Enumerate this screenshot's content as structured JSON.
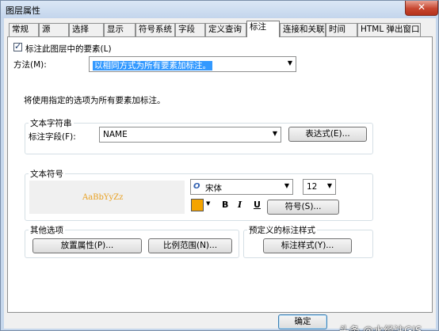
{
  "window": {
    "title": "图层属性",
    "close_glyph": "✕"
  },
  "tabs": [
    {
      "label": "常规"
    },
    {
      "label": "源"
    },
    {
      "label": "选择"
    },
    {
      "label": "显示"
    },
    {
      "label": "符号系统"
    },
    {
      "label": "字段"
    },
    {
      "label": "定义查询"
    },
    {
      "label": "标注"
    },
    {
      "label": "连接和关联"
    },
    {
      "label": "时间"
    },
    {
      "label": "HTML 弹出窗口"
    }
  ],
  "active_tab": "标注",
  "label_features": {
    "checked": true,
    "label": "标注此图层中的要素(L)"
  },
  "method": {
    "label": "方法(M):",
    "value": "以相同方式为所有要素加标注。"
  },
  "info_text": "将使用指定的选项为所有要素加标注。",
  "text_string": {
    "title": "文本字符串",
    "field_label": "标注字段(F):",
    "field_value": "NAME",
    "expression_button": "表达式(E)..."
  },
  "text_symbol": {
    "title": "文本符号",
    "preview": "AaBbYyZz",
    "font_value": "宋体",
    "size_value": "12",
    "color": "#f5a400",
    "bold": "B",
    "italic": "I",
    "underline": "U",
    "symbol_button": "符号(S)..."
  },
  "other_options": {
    "title": "其他选项",
    "placement_button": "放置属性(P)...",
    "scale_button": "比例范围(N)..."
  },
  "predefined": {
    "title": "预定义的标注样式",
    "style_button": "标注样式(Y)..."
  },
  "footer": {
    "ok": "确定"
  },
  "watermark": "头条 @水经注GIS"
}
